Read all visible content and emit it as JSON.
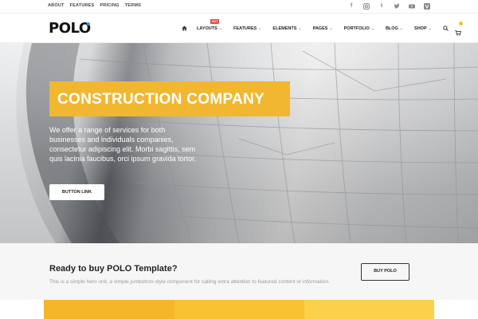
{
  "topbar": {
    "links": [
      "ABOUT",
      "FEATURES",
      "PRICING",
      "TERMS"
    ],
    "socials": [
      "facebook-icon",
      "instagram-icon",
      "tumblr-icon",
      "twitter-icon",
      "youtube-icon",
      "vine-icon"
    ]
  },
  "header": {
    "logo": "POLO",
    "nav": {
      "home_icon": "home-icon",
      "layouts": "LAYOUTS",
      "hot_badge": "HOT",
      "features": "FEATURES",
      "elements": "ELEMENTS",
      "pages": "PAGES",
      "portfolio": "PORTFOLIO",
      "blog": "BLOG",
      "shop": "SHOP",
      "chevron": "⌄"
    },
    "search_icon": "search-icon",
    "cart_icon": "cart-icon"
  },
  "hero": {
    "title": "CONSTRUCTION COMPANY",
    "text": "We offer a range of services for both businesses and individuals companies, consectetur adipiscing elit. Morbi sagittis, sem quis lacinia faucibus, orci ipsum gravida tortor.",
    "button": "BUTTON LINK"
  },
  "cta": {
    "title": "Ready to buy POLO Template?",
    "description": "This is a simple hero unit, a simple jumbotron-style component for calling extra attention to featured content or information.",
    "button": "BUY POLO"
  },
  "colors": {
    "accent": "#f2b731",
    "band_1": "#f5b72a",
    "band_2": "#f8c232",
    "band_3": "#fbd04a"
  }
}
